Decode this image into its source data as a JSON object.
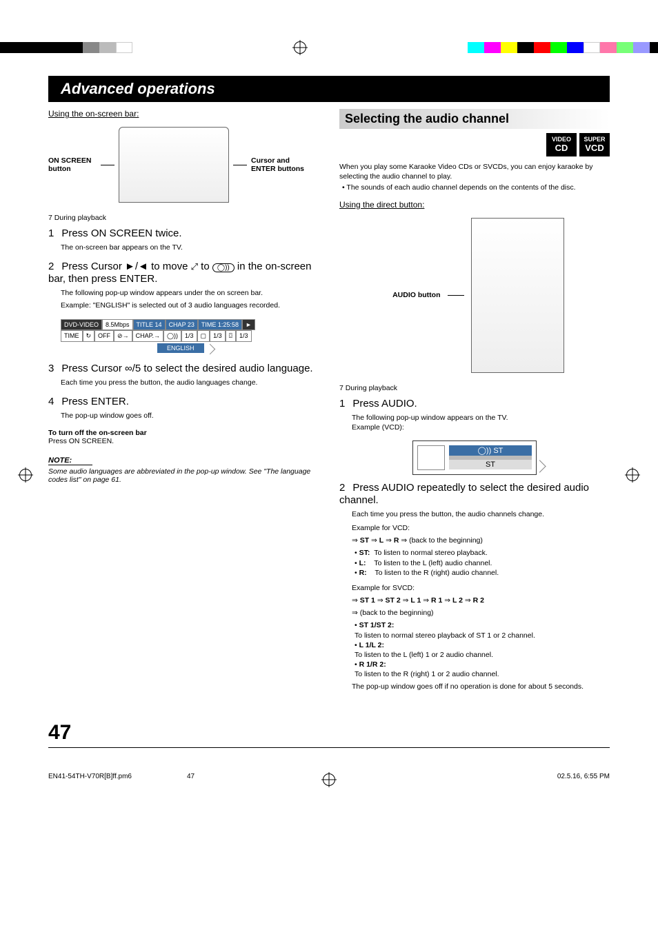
{
  "header": {
    "title": "Advanced operations"
  },
  "left": {
    "usingBar": "Using the on-screen bar:",
    "labelOnScreen": "ON SCREEN button",
    "labelCursor": "Cursor and ENTER buttons",
    "during": "During playback",
    "s1": {
      "n": "1",
      "t": "Press ON SCREEN twice.",
      "b": "The on-screen bar appears on the TV."
    },
    "s2": {
      "n": "2",
      "t_a": "Press Cursor ",
      "t_b": "3/2",
      "t_c": " to move ",
      "t_d": " to ",
      "t_e": " in the on-screen bar, then press ENTER.",
      "b1": "The following pop-up window appears under the on screen bar.",
      "b2a": "Example:",
      "b2b": " \"ENGLISH\" is selected out of 3 audio languages recorded."
    },
    "osd": {
      "r1": {
        "c1": "DVD-VIDEO",
        "c2": "8.5Mbps",
        "c3": "TITLE 14",
        "c4": "CHAP 23",
        "c5": "TIME 1:25:58",
        "c6": "3"
      },
      "r2": {
        "c1": "TIME",
        "c2": "OFF",
        "c3": "CHAP.",
        "c4": "1/3",
        "c5": "1/3",
        "c6": "1/3"
      },
      "drop": "ENGLISH"
    },
    "s3": {
      "n": "3",
      "t": "Press Cursor ∞/5 to select the desired audio language.",
      "b": "Each time you press the button, the audio languages change."
    },
    "s4": {
      "n": "4",
      "t": "Press ENTER.",
      "b": "The pop-up window goes off."
    },
    "turnoff": {
      "t": "To turn off  the on-screen bar",
      "b": "Press ON SCREEN."
    },
    "note": {
      "t": "NOTE:",
      "b": "Some audio languages are abbreviated in the pop-up window. See \"The language codes list\" on page 61."
    }
  },
  "right": {
    "head": "Selecting the audio channel",
    "badge1a": "VIDEO",
    "badge1b": "CD",
    "badge2a": "SUPER",
    "badge2b": "VCD",
    "intro1": "When you play some Karaoke Video CDs or SVCDs, you can enjoy karaoke by selecting the audio channel to play.",
    "intro2": "The sounds of each audio channel depends on the contents of the disc.",
    "usingDirect": "Using the direct button:",
    "labelAudio": "AUDIO button",
    "during": "During playback",
    "s1": {
      "n": "1",
      "t": "Press AUDIO.",
      "b1": "The following pop-up window appears on the TV.",
      "b2": "Example (VCD):"
    },
    "popup": {
      "top": "ST",
      "under": "ST"
    },
    "s2": {
      "n": "2",
      "t": "Press AUDIO repeatedly to select the desired audio channel.",
      "b1": "Each time you press the button, the audio channels change.",
      "exVCD": "Example for VCD:",
      "seqVCD": "] ST ] L ] R ] (back to the beginning)",
      "li1a": "ST:",
      "li1b": "To listen to normal stereo playback.",
      "li2a": "L:",
      "li2b": "To listen to the L (left) audio channel.",
      "li3a": "R:",
      "li3b": "To listen to the R (right) audio channel.",
      "exSVCD": "Example for SVCD:",
      "seqSVCD1": "] ST 1 ] ST 2 ] L 1 ] R 1 ] L 2 ] R 2",
      "seqSVCD2": "] (back to the beginning)",
      "li4a": "ST 1/ST 2:",
      "li4b": "To listen to normal stereo playback of ST 1 or 2 channel.",
      "li5a": "L 1/L 2:",
      "li5b": "To listen to the L (left) 1 or 2 audio channel.",
      "li6a": "R 1/R 2:",
      "li6b": "To listen to the R (right) 1 or 2 audio channel.",
      "tail": "The pop-up window goes off if no operation is done for about 5 seconds."
    }
  },
  "pagenum": "47",
  "footer": {
    "file": "EN41-54TH-V70R[B]ff.pm6",
    "page": "47",
    "date": "02.5.16, 6:55 PM"
  },
  "colors": {
    "leftBars": [
      "#000",
      "#000",
      "#000",
      "#000",
      "#000",
      "#888",
      "#bbb",
      "#fff"
    ],
    "rightBars": [
      "#0ff",
      "#f0f",
      "#ff0",
      "#000",
      "#f00",
      "#0f0",
      "#00f",
      "#fff",
      "#f5a",
      "#5f5",
      "#aaf",
      "#000"
    ]
  }
}
